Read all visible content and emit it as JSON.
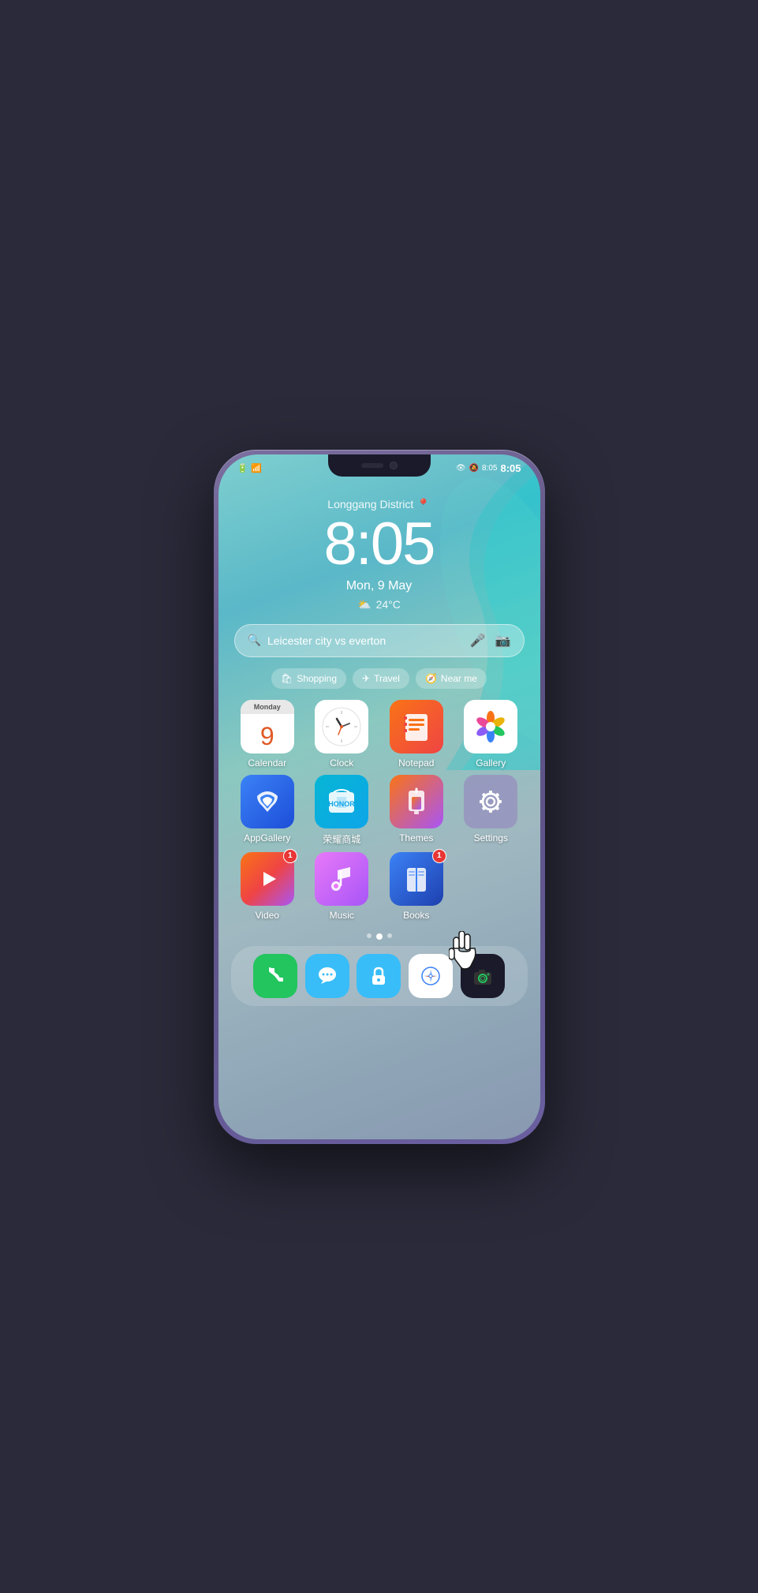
{
  "phone": {
    "status_bar": {
      "left_icons": [
        "battery",
        "wifi"
      ],
      "time": "8:05",
      "right_icons": [
        "eye",
        "bell-off",
        "battery-67"
      ]
    },
    "lock_screen": {
      "location": "Longgang District",
      "time": "8:05",
      "date": "Mon, 9 May",
      "weather": "24°C"
    },
    "search": {
      "placeholder": "Leicester city vs everton",
      "quick_links": [
        "Shopping",
        "Travel",
        "Near me"
      ]
    },
    "apps_row1": [
      {
        "name": "Calendar",
        "type": "calendar",
        "day": "Monday",
        "number": "9"
      },
      {
        "name": "Clock",
        "type": "clock"
      },
      {
        "name": "Notepad",
        "type": "notepad"
      },
      {
        "name": "Gallery",
        "type": "gallery"
      }
    ],
    "apps_row2": [
      {
        "name": "AppGallery",
        "type": "appgallery"
      },
      {
        "name": "荣耀商城",
        "type": "honor"
      },
      {
        "name": "Themes",
        "type": "themes"
      },
      {
        "name": "Settings",
        "type": "settings"
      }
    ],
    "apps_row3": [
      {
        "name": "Video",
        "type": "video",
        "badge": "1"
      },
      {
        "name": "Music",
        "type": "music"
      },
      {
        "name": "Books",
        "type": "books",
        "badge": "1"
      },
      {
        "name": "",
        "type": "empty"
      }
    ],
    "dock": [
      {
        "name": "Phone",
        "type": "phone"
      },
      {
        "name": "Messages",
        "type": "messages"
      },
      {
        "name": "Lock",
        "type": "lock"
      },
      {
        "name": "Browser",
        "type": "browser"
      },
      {
        "name": "Camera",
        "type": "camera"
      }
    ],
    "page_dots": [
      false,
      true,
      false
    ]
  }
}
